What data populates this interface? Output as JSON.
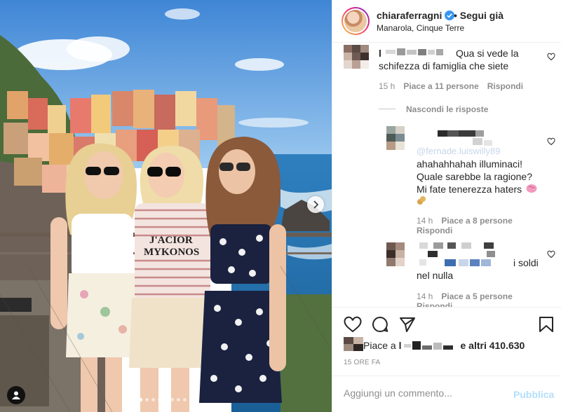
{
  "post": {
    "username": "chiaraferragni",
    "follow_label": "• Segui già",
    "location": "Manarola, Cinque Terre",
    "verified_icon": "verified-badge-icon",
    "accent": "#3897f0"
  },
  "photo": {
    "shirt_text_1": "J'ACIOR",
    "shirt_text_2": "MYKONOS",
    "carousel_dots": 9,
    "active_dot": 0
  },
  "comments": {
    "c1": {
      "text_line1": "Qua si vede la",
      "text_line2": "schifezza di famiglia che siete",
      "time": "15 h",
      "likes": "Piace a 11 persone",
      "reply": "Rispondi"
    },
    "hide_replies": "Nascondi le risposte",
    "r1": {
      "mention": "@fernade.luiswilly89",
      "line1": "ahahahhahah illuminaci!",
      "line2": "Quale sarebbe la ragione?",
      "line3": "Mi fate tenerezza haters",
      "time": "14 h",
      "likes": "Piace a 8 persone",
      "reply": "Rispondi"
    },
    "r2": {
      "text_end": "i soldi",
      "line2": "nel nulla",
      "time": "14 h",
      "likes": "Piace a 5 persone",
      "reply": "Rispondi"
    }
  },
  "footer": {
    "likes_prefix": "Piace a ",
    "likes_partial": "l",
    "likes_suffix": "e altri 410.630",
    "time_ago": "15 ORE FA",
    "comment_placeholder": "Aggiungi un commento...",
    "publish_label": "Pubblica"
  },
  "icons": {
    "like": "heart-icon",
    "comment": "comment-icon",
    "share": "paper-plane-icon",
    "save": "bookmark-icon",
    "next": "chevron-right-icon",
    "tags": "user-tag-icon"
  }
}
